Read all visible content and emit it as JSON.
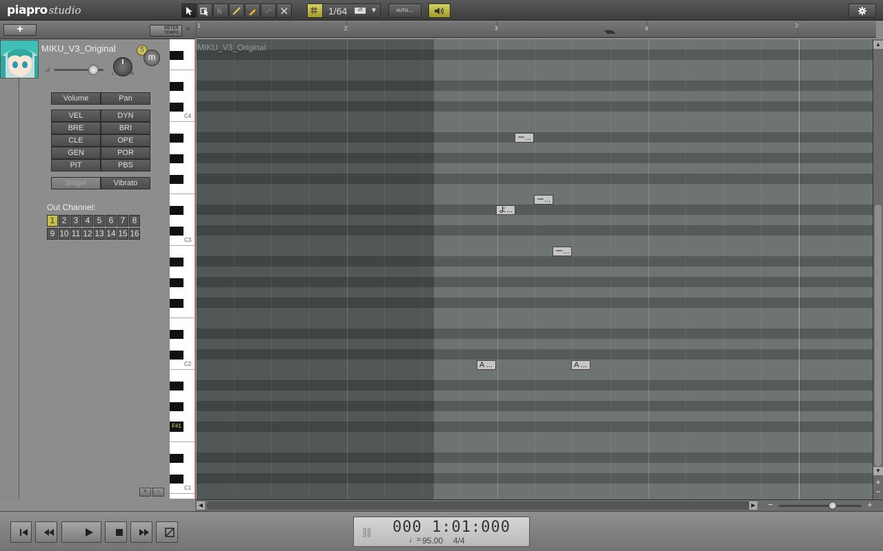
{
  "app": {
    "logo_main": "piapro",
    "logo_sub": "studio"
  },
  "toolbar": {
    "quantize": "1/64",
    "quantize_tag": "off",
    "auto_label": "AUTO.....",
    "settings_icon": "gear-icon"
  },
  "track": {
    "name": "MIKU_V3_Original",
    "badge": "5",
    "mute": "m",
    "meter_tempo": "METER TEMPO",
    "volume_label": "Volume",
    "pan_label": "Pan",
    "params": [
      [
        "VEL",
        "DYN"
      ],
      [
        "BRE",
        "BRI"
      ],
      [
        "CLE",
        "OPE"
      ],
      [
        "GEN",
        "POR"
      ],
      [
        "PIT",
        "PBS"
      ]
    ],
    "singer_label": "Singer",
    "vibrato_label": "Vibrato",
    "pan_l": "L",
    "pan_r": "R",
    "out_channel_label": "Out Channel:",
    "channels": [
      "1",
      "2",
      "3",
      "4",
      "5",
      "6",
      "7",
      "8",
      "9",
      "10",
      "11",
      "12",
      "13",
      "14",
      "15",
      "16"
    ],
    "selected_channel": "1"
  },
  "ruler": {
    "labels": [
      "1",
      "2",
      "3",
      "4",
      "2"
    ]
  },
  "keyboard": {
    "labels": [
      "C4",
      "C3",
      "C2",
      "F#1",
      "C1"
    ]
  },
  "roll": {
    "track_label": "MIKU_V3_Original",
    "notes": [
      "ー...",
      "ー...",
      "よ...",
      "ー...",
      "A ...",
      "A ..."
    ]
  },
  "transport": {
    "position": "000 1:01:000",
    "tempo": "95.00",
    "meter": "4/4"
  },
  "colors": {
    "accent": "#c7c04a",
    "note": "#c6c6c6",
    "playhead": "#c44444"
  }
}
